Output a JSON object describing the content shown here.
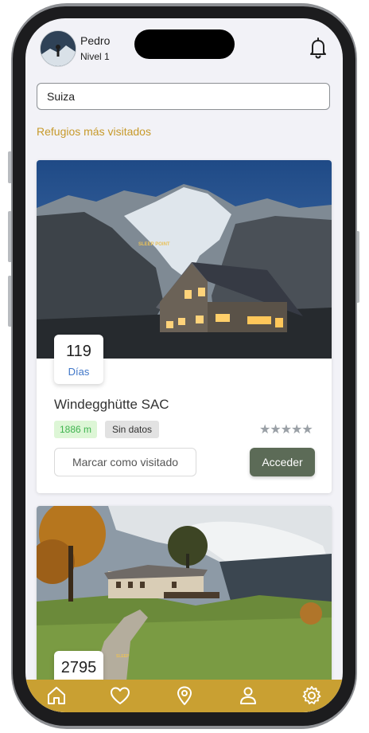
{
  "user": {
    "name": "Pedro",
    "level": "Nivel 1"
  },
  "search": {
    "value": "Suiza"
  },
  "section_title": "Refugios más visitados",
  "cards": [
    {
      "days": "119",
      "days_label": "Días",
      "title": "Windegghütte SAC",
      "altitude": "1886 m",
      "info": "Sin datos",
      "rating_stars": "★★★★★",
      "visit_label": "Marcar como visitado",
      "access_label": "Acceder",
      "watermark": "SLEEP POINT"
    },
    {
      "days": "2795",
      "watermark": "SLEEP"
    }
  ],
  "tabbar": {
    "items": [
      "home-icon",
      "heart-icon",
      "location-pin-icon",
      "user-icon",
      "settings-icon"
    ]
  },
  "colors": {
    "accent": "#c9a032",
    "section_title": "#c79a2b",
    "access_button": "#5c6b57",
    "days_label": "#3f76c8",
    "altitude_badge_text": "#3fb34f",
    "altitude_badge_bg": "#ddf6d6"
  }
}
